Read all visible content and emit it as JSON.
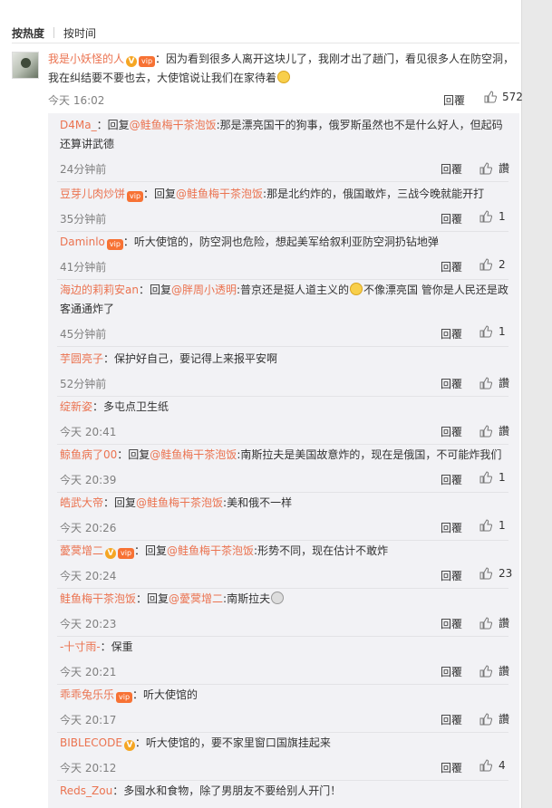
{
  "tabs": [
    {
      "label": "按热度",
      "active": true
    },
    {
      "label": "按时间",
      "active": false
    }
  ],
  "main_comment": {
    "username": "我是小妖怪的人",
    "text": "：因为看到很多人离开这块儿了，我刚才出了趟门，看见很多人在防空洞，我在纠结要不要也去，大使馆说让我们在家待着",
    "time": "今天 16:02",
    "reply_label": "回覆",
    "likes": "572"
  },
  "replies": [
    {
      "username": "D4Ma_",
      "reply_to": "@鲑鱼梅干茶泡饭",
      "text": ":那是漂亮国干的狗事，俄罗斯虽然也不是什么好人，但起码还算讲武德",
      "time": "24分钟前",
      "reply_label": "回覆",
      "likes": "讚"
    },
    {
      "username": "豆芽儿肉炒饼",
      "reply_to": "@鲑鱼梅干茶泡饭",
      "text": ":那是北约炸的，俄国敢炸，三战今晚就能开打",
      "time": "35分钟前",
      "reply_label": "回覆",
      "likes": "1"
    },
    {
      "username": "Daminlo",
      "reply_to": "",
      "text": "：听大使馆的，防空洞也危险，想起美军给叙利亚防空洞扔钻地弹",
      "time": "41分钟前",
      "reply_label": "回覆",
      "likes": "2"
    },
    {
      "username": "海边的莉莉安an",
      "reply_to": "@胖周小透明",
      "text": ":普京还是挺人道主义的",
      "text2": "不像漂亮国 管你是人民还是政客通通炸了",
      "time": "45分钟前",
      "reply_label": "回覆",
      "likes": "1"
    },
    {
      "username": "芋圆亮子",
      "reply_to": "",
      "text": "：保护好自己，要记得上来报平安啊",
      "time": "52分钟前",
      "reply_label": "回覆",
      "likes": "讚"
    },
    {
      "username": "绽新姿",
      "reply_to": "",
      "text": "：多屯点卫生纸",
      "time": "今天 20:41",
      "reply_label": "回覆",
      "likes": "讚"
    },
    {
      "username": "鲸鱼病了00",
      "reply_to": "@鲑鱼梅干茶泡饭",
      "text": ":南斯拉夫是美国故意炸的，现在是俄国，不可能炸我们",
      "time": "今天 20:39",
      "reply_label": "回覆",
      "likes": "1"
    },
    {
      "username": "皓武大帝",
      "reply_to": "@鲑鱼梅干茶泡饭",
      "text": ":美和俄不一样",
      "time": "今天 20:26",
      "reply_label": "回覆",
      "likes": "1"
    },
    {
      "username": "薆蓂增二",
      "reply_to": "@鲑鱼梅干茶泡饭",
      "text": ":形势不同，现在估计不敢炸",
      "time": "今天 20:24",
      "reply_label": "回覆",
      "likes": "23"
    },
    {
      "username": "鲑鱼梅干茶泡饭",
      "reply_to": "@薆蓂增二",
      "text": ":南斯拉夫",
      "time": "今天 20:23",
      "reply_label": "回覆",
      "likes": "讚"
    },
    {
      "username": "-十寸雨-",
      "reply_to": "",
      "text": "：保重",
      "time": "今天 20:21",
      "reply_label": "回覆",
      "likes": "讚"
    },
    {
      "username": "乖乖兔乐乐",
      "reply_to": "",
      "text": "：听大使馆的",
      "time": "今天 20:17",
      "reply_label": "回覆",
      "likes": "讚"
    },
    {
      "username": "BIBLECODE",
      "reply_to": "",
      "text": "：听大使馆的，要不家里窗口国旗挂起来",
      "time": "今天 20:12",
      "reply_label": "回覆",
      "likes": "4"
    },
    {
      "username": "Reds_Zou",
      "reply_to": "",
      "text": "：多囤水和食物，除了男朋友不要给别人开门！",
      "time": "",
      "reply_label": "",
      "likes": ""
    }
  ],
  "reply_prefix": "：回复",
  "badge_v_text": "V",
  "badge_vip_text": "vip",
  "colors": {
    "link": "#eb7350",
    "time": "#808080",
    "reply_bg": "#f2f2f5"
  }
}
